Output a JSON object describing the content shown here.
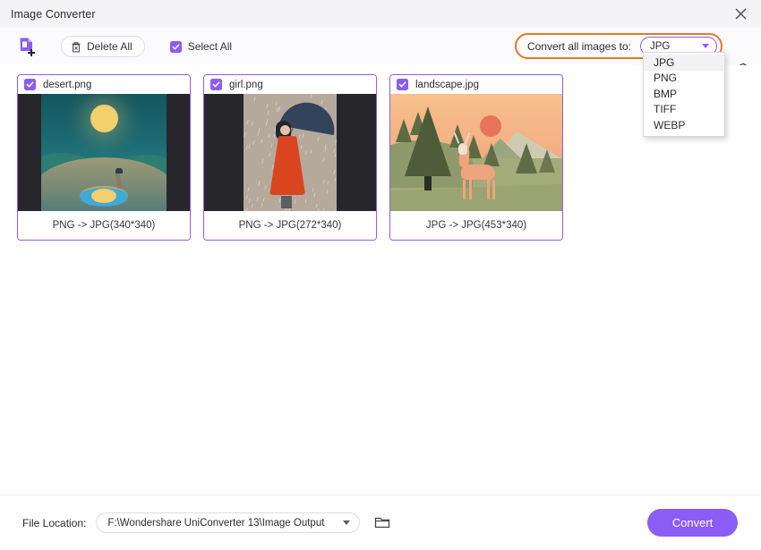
{
  "window": {
    "title": "Image Converter",
    "close_icon": "close-icon"
  },
  "toolbar": {
    "add_file_icon": "add-file-icon",
    "delete_all_label": "Delete All",
    "delete_all_icon": "trash-icon",
    "select_all_label": "Select All",
    "select_all_checked": true,
    "convert_all_label": "Convert all images to:",
    "format_value": "JPG",
    "format_caret_icon": "chevron-down-icon",
    "settings_icon": "settings-icon",
    "highlight_color": "#e8762a",
    "accent_color": "#8b5cf6"
  },
  "format_dropdown": {
    "open": true,
    "selected": "JPG",
    "options": [
      "JPG",
      "PNG",
      "BMP",
      "TIFF",
      "WEBP"
    ]
  },
  "cards": [
    {
      "name": "desert.png",
      "checked": true,
      "conversion": "PNG -> JPG(340*340)",
      "art": "desert"
    },
    {
      "name": "girl.png",
      "checked": true,
      "conversion": "PNG -> JPG(272*340)",
      "art": "girl"
    },
    {
      "name": "landscape.jpg",
      "checked": true,
      "conversion": "JPG -> JPG(453*340)",
      "art": "landscape"
    }
  ],
  "footer": {
    "file_location_label": "File Location:",
    "file_location_value": "F:\\Wondershare UniConverter 13\\Image Output",
    "file_location_caret_icon": "chevron-down-icon",
    "folder_icon": "folder-icon",
    "convert_label": "Convert"
  }
}
